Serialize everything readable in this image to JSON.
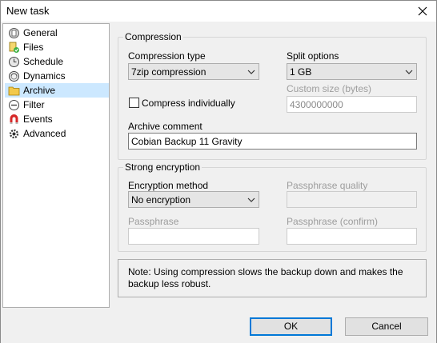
{
  "window": {
    "title": "New task"
  },
  "sidebar": {
    "items": [
      {
        "label": "General",
        "icon": "general-icon"
      },
      {
        "label": "Files",
        "icon": "files-icon"
      },
      {
        "label": "Schedule",
        "icon": "schedule-icon"
      },
      {
        "label": "Dynamics",
        "icon": "dynamics-icon"
      },
      {
        "label": "Archive",
        "icon": "archive-icon",
        "selected": true
      },
      {
        "label": "Filter",
        "icon": "filter-icon"
      },
      {
        "label": "Events",
        "icon": "events-icon"
      },
      {
        "label": "Advanced",
        "icon": "advanced-icon"
      }
    ]
  },
  "compression": {
    "group_title": "Compression",
    "type_label": "Compression type",
    "type_value": "7zip compression",
    "split_label": "Split options",
    "split_value": "1 GB",
    "custom_size_label": "Custom size (bytes)",
    "custom_size_value": "4300000000",
    "compress_individually_label": "Compress individually",
    "compress_individually_checked": false,
    "comment_label": "Archive comment",
    "comment_value": "Cobian Backup 11 Gravity"
  },
  "encryption": {
    "group_title": "Strong encryption",
    "method_label": "Encryption method",
    "method_value": "No encryption",
    "quality_label": "Passphrase quality",
    "passphrase_label": "Passphrase",
    "passphrase_value": "",
    "confirm_label": "Passphrase (confirm)",
    "confirm_value": ""
  },
  "note": {
    "text": "Note: Using compression slows the backup down and makes the backup less robust."
  },
  "buttons": {
    "ok": "OK",
    "cancel": "Cancel"
  },
  "colors": {
    "selection": "#cce8ff",
    "accent": "#0078d7",
    "disabled_text": "#9d9d9d"
  }
}
